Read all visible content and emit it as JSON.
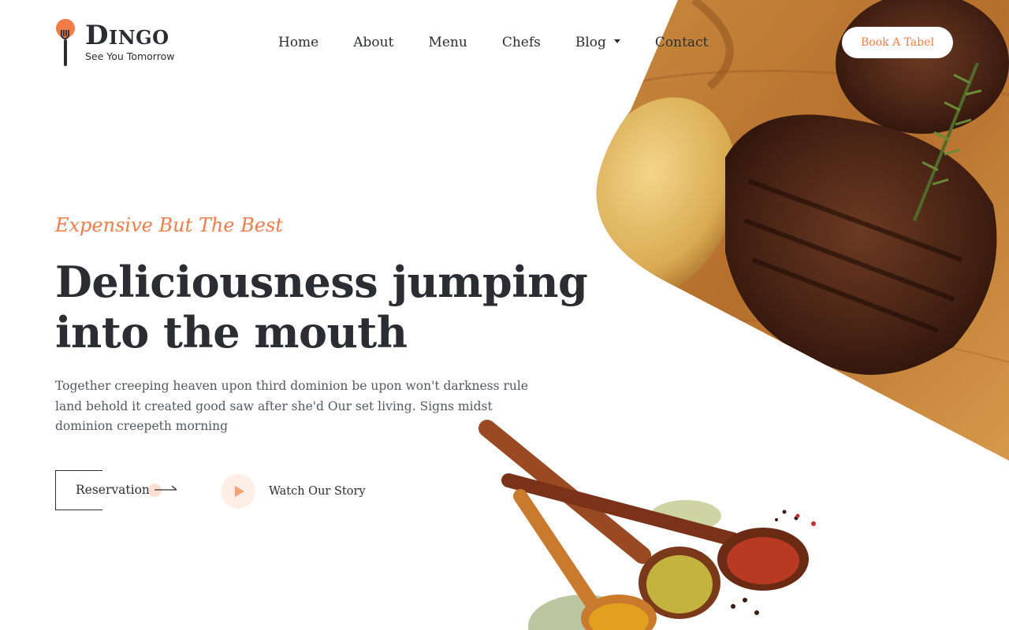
{
  "brand": {
    "name": "Dingo",
    "tagline": "See You Tomorrow"
  },
  "nav": {
    "items": [
      "Home",
      "About",
      "Menu",
      "Chefs",
      "Blog",
      "Contact"
    ]
  },
  "header": {
    "cta_label": "Book A Tabel"
  },
  "hero": {
    "eyebrow": "Expensive But The Best",
    "headline_line1": "Deliciousness jumping",
    "headline_line2": "into the mouth",
    "desc_line1": "Together creeping heaven upon third dominion be upon won't darkness rule",
    "desc_line2": "land behold it created good saw after she'd Our set living. Signs midst",
    "desc_line3": "dominion creepeth morning",
    "reservation_label": "Reservation",
    "watch_label": "Watch Our Story"
  },
  "colors": {
    "accent": "#f07c47",
    "text": "#2b2d33",
    "muted": "#555860"
  }
}
